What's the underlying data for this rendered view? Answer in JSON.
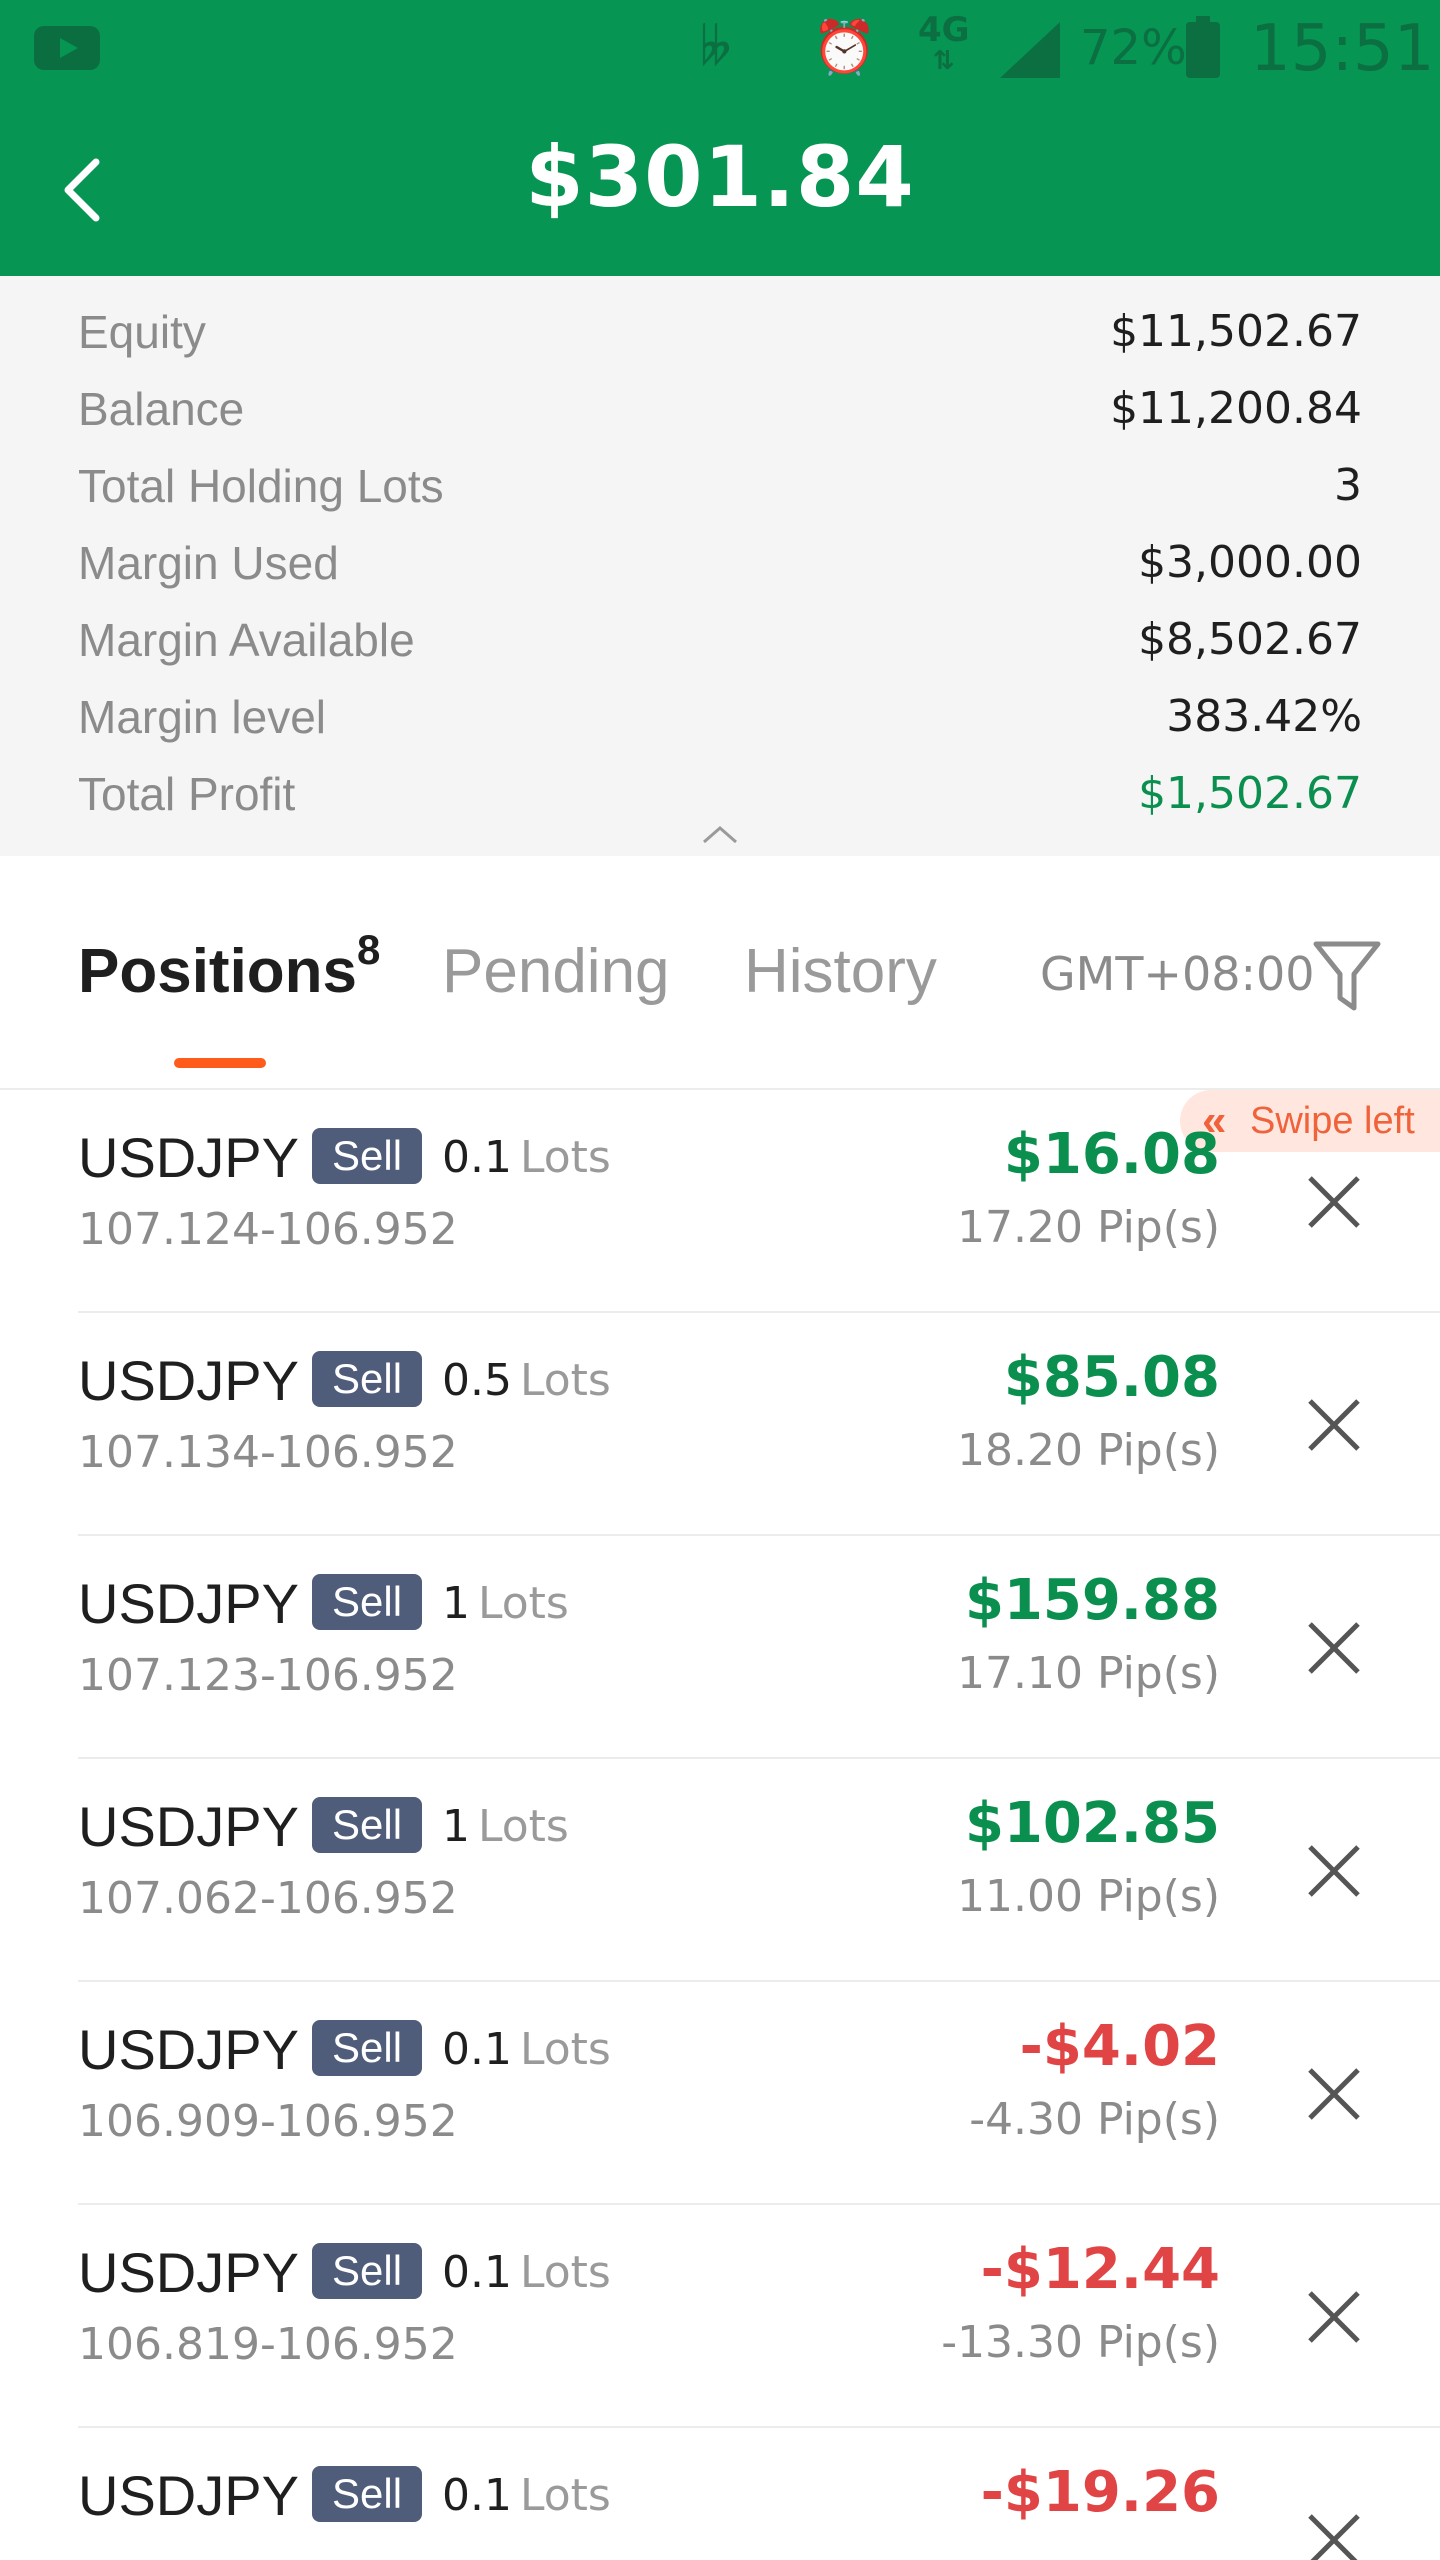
{
  "status_bar": {
    "network": "4G",
    "battery": "72%",
    "time": "15:51",
    "icons": [
      "youtube-icon",
      "vibrate-icon",
      "alarm-icon",
      "signal-icon",
      "battery-icon"
    ]
  },
  "header": {
    "title": "$301.84",
    "back_icon": "chevron-left-icon",
    "background": "#069553"
  },
  "summary": {
    "rows": [
      {
        "label": "Equity",
        "value": "$11,502.67"
      },
      {
        "label": "Balance",
        "value": "$11,200.84"
      },
      {
        "label": "Total Holding Lots",
        "value": "3"
      },
      {
        "label": "Margin Used",
        "value": "$3,000.00"
      },
      {
        "label": "Margin Available",
        "value": "$8,502.67"
      },
      {
        "label": "Margin level",
        "value": "383.42%"
      },
      {
        "label": "Total Profit",
        "value": "$1,502.67"
      }
    ]
  },
  "tabs": {
    "positions": {
      "label": "Positions",
      "count": "8"
    },
    "pending": {
      "label": "Pending"
    },
    "history": {
      "label": "History"
    },
    "timezone": "GMT+08:00",
    "filter_icon": "filter-icon",
    "accent": "#ff5b1a"
  },
  "hint": {
    "swipe": "Swipe left"
  },
  "positions": [
    {
      "symbol": "USDJPY",
      "side": "Sell",
      "lots": "0.1",
      "lots_unit": "Lots",
      "prices": "107.124-106.952",
      "pnl": "$16.08",
      "pips": "17.20 Pip(s)"
    },
    {
      "symbol": "USDJPY",
      "side": "Sell",
      "lots": "0.5",
      "lots_unit": "Lots",
      "prices": "107.134-106.952",
      "pnl": "$85.08",
      "pips": "18.20 Pip(s)"
    },
    {
      "symbol": "USDJPY",
      "side": "Sell",
      "lots": "1",
      "lots_unit": "Lots",
      "prices": "107.123-106.952",
      "pnl": "$159.88",
      "pips": "17.10 Pip(s)"
    },
    {
      "symbol": "USDJPY",
      "side": "Sell",
      "lots": "1",
      "lots_unit": "Lots",
      "prices": "107.062-106.952",
      "pnl": "$102.85",
      "pips": "11.00 Pip(s)"
    },
    {
      "symbol": "USDJPY",
      "side": "Sell",
      "lots": "0.1",
      "lots_unit": "Lots",
      "prices": "106.909-106.952",
      "pnl": "-$4.02",
      "pips": "-4.30 Pip(s)"
    },
    {
      "symbol": "USDJPY",
      "side": "Sell",
      "lots": "0.1",
      "lots_unit": "Lots",
      "prices": "106.819-106.952",
      "pnl": "-$12.44",
      "pips": "-13.30 Pip(s)"
    },
    {
      "symbol": "USDJPY",
      "side": "Sell",
      "lots": "0.1",
      "lots_unit": "Lots",
      "prices": "",
      "pnl": "-$19.26",
      "pips": ""
    }
  ],
  "colors": {
    "profit": "#0a8f4f",
    "loss": "#e04444",
    "side_badge": "#4f5d7a"
  }
}
